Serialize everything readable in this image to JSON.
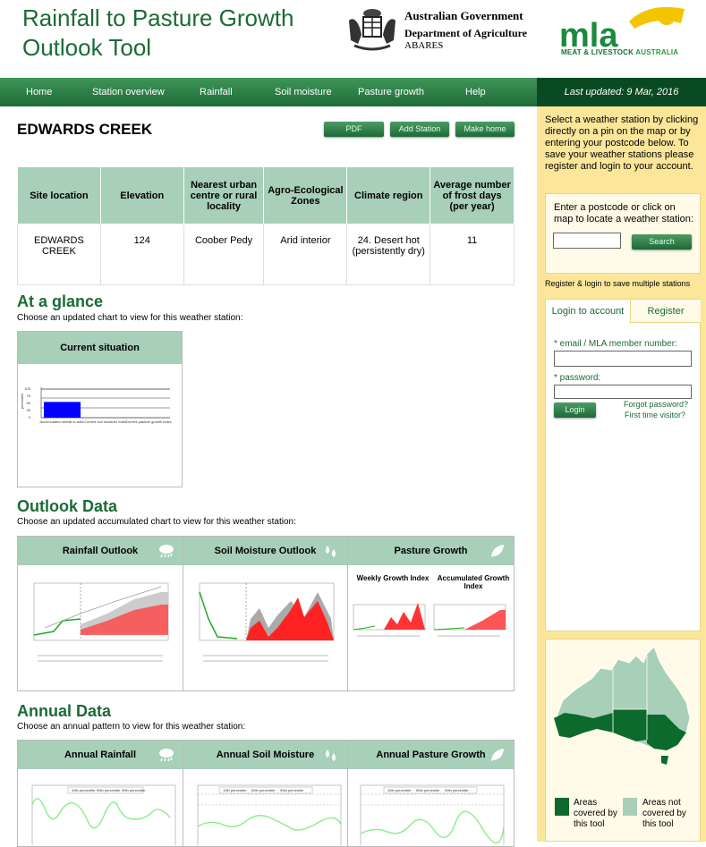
{
  "header": {
    "title_line1": "Rainfall to Pasture Growth",
    "title_line2": "Outlook Tool",
    "gov_line1": "Australian Government",
    "gov_line2": "Department of Agriculture",
    "gov_line3": "ABARES",
    "mla_logo_text": "mla",
    "mla_sub_a": "MEAT & LIVESTOCK ",
    "mla_sub_b": "AUSTRALIA"
  },
  "nav": {
    "items": [
      "Home",
      "Station overview",
      "Rainfall",
      "Soil moisture",
      "Pasture growth",
      "Help"
    ],
    "last_updated": "Last updated: 9 Mar, 2016"
  },
  "station": {
    "name": "EDWARDS CREEK",
    "buttons": [
      "PDF",
      "Add Station",
      "Make home"
    ]
  },
  "site_table": {
    "headers": [
      "Site location",
      "Elevation",
      "Nearest urban centre or rural locality",
      "Agro-Ecological Zones",
      "Climate region",
      "Average number of frost days (per year)"
    ],
    "row": [
      "EDWARDS CREEK",
      "124",
      "Coober Pedy",
      "Arid interior",
      "24. Desert hot (persistently dry)",
      "11"
    ]
  },
  "at_a_glance": {
    "title": "At a glance",
    "subtitle": "Choose an updated chart to view for this weather station:",
    "card_title": "Current situation",
    "chart": {
      "ylabel": "percentile",
      "yticks": [
        "100",
        "75",
        "50",
        "25",
        "0"
      ],
      "bar_value": 55,
      "categories": [
        "Accumulated rainfall to date",
        "Current soil moisture index",
        "Current pasture growth index"
      ]
    }
  },
  "outlook": {
    "title": "Outlook Data",
    "subtitle": "Choose an updated accumulated chart to view for this weather station:",
    "cards": [
      "Rainfall Outlook",
      "Soil Moisture Outlook",
      "Pasture Growth"
    ],
    "pasture_sub": [
      "Weekly Growth Index",
      "Accumulated Growth Index"
    ]
  },
  "annual": {
    "title": "Annual Data",
    "subtitle": "Choose an annual pattern to view for this weather station:",
    "cards": [
      "Annual Rainfall",
      "Annual Soil Moisture",
      "Annual Pasture Growth"
    ],
    "legend": [
      "10th percentile",
      "50th percentile",
      "90th percentile"
    ]
  },
  "sidebar": {
    "intro": "Select a weather station by clicking directly on a pin on the map or by entering your postcode below. To save your weather stations please register and login to your account.",
    "postcode_prompt": "Enter a postcode or click on map to locate a weather station:",
    "search_label": "Search",
    "register_note": "Register & login to save multiple stations",
    "tab_login": "Login to account",
    "tab_register": "Register",
    "email_label": "* email / MLA member number:",
    "password_label": "* password:",
    "login_label": "Login",
    "forgot": "Forgot password?",
    "first_time": "First time visitor?",
    "legend_covered": "Areas covered by this tool",
    "legend_not": "Areas not covered by this tool"
  },
  "colors": {
    "brand_green": "#1b6b35",
    "header_teal": "#a8cfb8",
    "sidebar_yellow": "#fbe69a",
    "covered": "#0d6a2d",
    "not_covered": "#a8cfb8"
  }
}
